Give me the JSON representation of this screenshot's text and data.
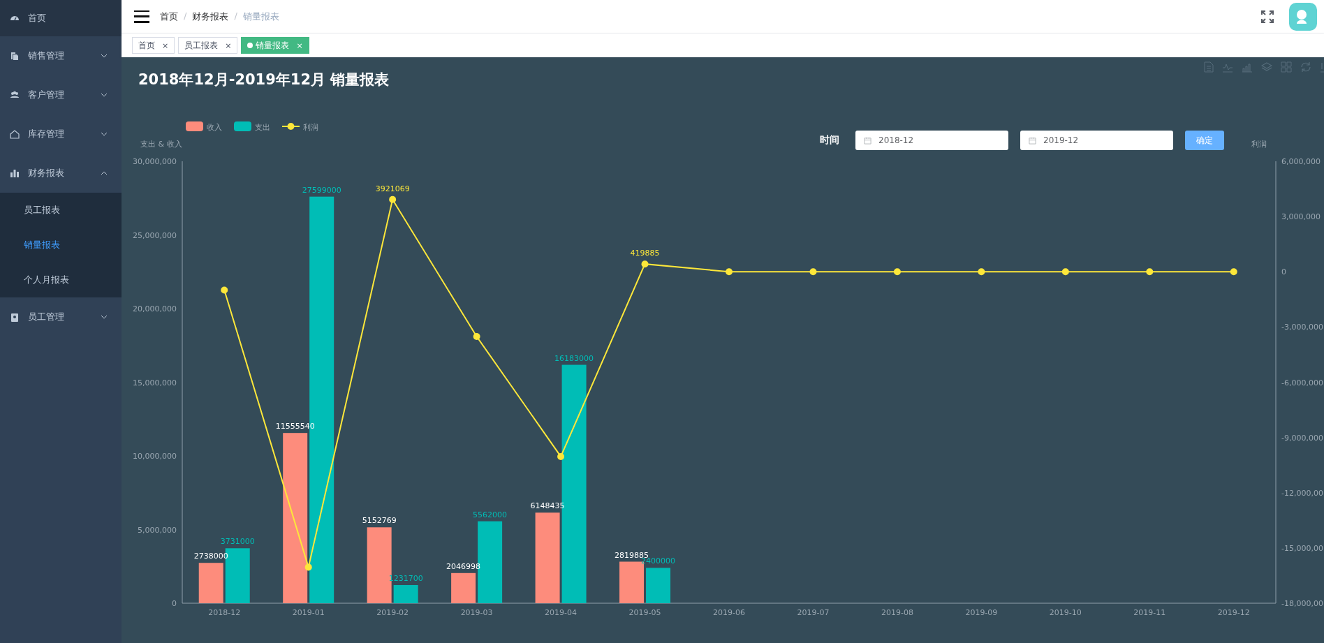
{
  "sidebar": {
    "items": [
      {
        "kind": "link",
        "label": "首页"
      },
      {
        "kind": "group",
        "label": "销售管理",
        "expanded": false
      },
      {
        "kind": "group",
        "label": "客户管理",
        "expanded": false
      },
      {
        "kind": "group",
        "label": "库存管理",
        "expanded": false
      },
      {
        "kind": "group",
        "label": "财务报表",
        "expanded": true,
        "children": [
          {
            "label": "员工报表",
            "selected": false
          },
          {
            "label": "销量报表",
            "selected": true
          },
          {
            "label": "个人月报表",
            "selected": false
          }
        ]
      },
      {
        "kind": "group",
        "label": "员工管理",
        "expanded": false
      }
    ]
  },
  "breadcrumb": [
    {
      "label": "首页"
    },
    {
      "separator": "/",
      "label": "财务报表"
    },
    {
      "separator": "/",
      "label": "销量报表"
    }
  ],
  "tabs": [
    {
      "label": "首页",
      "close": "×",
      "selected": false
    },
    {
      "label": "员工报表",
      "close": "×",
      "selected": false
    },
    {
      "label": "销量报表",
      "close": "×",
      "selected": true
    }
  ],
  "report": {
    "title": "2018年12月-2019年12月 销量报表",
    "filter": {
      "label": "时间",
      "start": "2018-12",
      "end": "2019-12",
      "button": "确定"
    },
    "chart_data": {
      "type": "bar",
      "ylabel": "支出 & 收入",
      "stacked": false,
      "legend": "top-left",
      "categories": [
        "2018-12",
        "2019-01",
        "2019-02",
        "2019-03",
        "2019-04",
        "2019-05",
        "2019-06",
        "2019-07",
        "2019-08",
        "2019-09",
        "2019-10",
        "2019-11",
        "2019-12"
      ],
      "ylim": [
        0,
        30000000
      ],
      "yticks": [
        {
          "value": 0,
          "label": "0"
        },
        {
          "value": 5000000,
          "label": "5,000,000"
        },
        {
          "value": 10000000,
          "label": "10,000,000"
        },
        {
          "value": 15000000,
          "label": "15,000,000"
        },
        {
          "value": 20000000,
          "label": "20,000,000"
        },
        {
          "value": 25000000,
          "label": "25,000,000"
        },
        {
          "value": 30000000,
          "label": "30,000,000"
        }
      ],
      "data_labels": true,
      "series": [
        {
          "name": "收入",
          "color": "#fd8c7c",
          "values": [
            2738000,
            11555540,
            5152769,
            2046998,
            6148435,
            2819885,
            null,
            null,
            null,
            null,
            null,
            null,
            null
          ]
        },
        {
          "name": "支出",
          "color": "#00bdb6",
          "values": [
            3731000,
            27599000,
            1231700,
            5562000,
            16183000,
            2400000,
            null,
            null,
            null,
            null,
            null,
            null,
            null
          ]
        }
      ]
    },
    "profit": {
      "chart_data": {
        "type": "line",
        "ylabel": "利润",
        "ylim": [
          -18000000,
          6000000
        ],
        "yticks": [
          {
            "value": 6000000,
            "label": "6,000,000"
          },
          {
            "value": 3000000,
            "label": "3,000,000"
          },
          {
            "value": 0,
            "label": "0"
          },
          {
            "value": -3000000,
            "label": "-3,000,000"
          },
          {
            "value": -6000000,
            "label": "-6,000,000"
          },
          {
            "value": -9000000,
            "label": "-9,000,000"
          },
          {
            "value": -12000000,
            "label": "-12,000,00"
          },
          {
            "value": -15000000,
            "label": "-15,000,00"
          },
          {
            "value": -18000000,
            "label": "-18,000,00"
          }
        ],
        "value_labels": [
          null,
          null,
          "3921069",
          null,
          null,
          "419885",
          null,
          null,
          null,
          null,
          null,
          null,
          null
        ],
        "series": [
          {
            "name": "利润",
            "color": "#fde73a",
            "marker": "circle",
            "values": [
              -993000,
              -16043460,
              3921069,
              -3515002,
              -10034565,
              419885,
              0,
              0,
              0,
              0,
              0,
              0,
              0
            ]
          }
        ]
      }
    }
  }
}
